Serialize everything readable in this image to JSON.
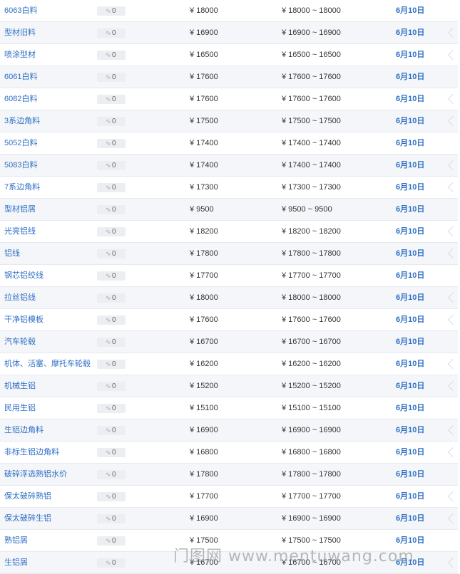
{
  "currency_symbol": "¥",
  "range_separator": "~",
  "change_icon": "trend-icon",
  "watermark_text": "门图网 www.mentuwang.com",
  "rows": [
    {
      "name": "6063白料",
      "change": "0",
      "price": "18000",
      "low": "18000",
      "high": "18000",
      "date": "6月10日"
    },
    {
      "name": "型材旧料",
      "change": "0",
      "price": "16900",
      "low": "16900",
      "high": "16900",
      "date": "6月10日"
    },
    {
      "name": "喷涂型材",
      "change": "0",
      "price": "16500",
      "low": "16500",
      "high": "16500",
      "date": "6月10日"
    },
    {
      "name": "6061白料",
      "change": "0",
      "price": "17600",
      "low": "17600",
      "high": "17600",
      "date": "6月10日"
    },
    {
      "name": "6082白料",
      "change": "0",
      "price": "17600",
      "low": "17600",
      "high": "17600",
      "date": "6月10日"
    },
    {
      "name": "3系边角料",
      "change": "0",
      "price": "17500",
      "low": "17500",
      "high": "17500",
      "date": "6月10日"
    },
    {
      "name": "5052白料",
      "change": "0",
      "price": "17400",
      "low": "17400",
      "high": "17400",
      "date": "6月10日"
    },
    {
      "name": "5083白料",
      "change": "0",
      "price": "17400",
      "low": "17400",
      "high": "17400",
      "date": "6月10日"
    },
    {
      "name": "7系边角料",
      "change": "0",
      "price": "17300",
      "low": "17300",
      "high": "17300",
      "date": "6月10日"
    },
    {
      "name": "型材铝屑",
      "change": "0",
      "price": "9500",
      "low": "9500",
      "high": "9500",
      "date": "6月10日"
    },
    {
      "name": "光亮铝线",
      "change": "0",
      "price": "18200",
      "low": "18200",
      "high": "18200",
      "date": "6月10日"
    },
    {
      "name": "铝线",
      "change": "0",
      "price": "17800",
      "low": "17800",
      "high": "17800",
      "date": "6月10日"
    },
    {
      "name": "钢芯铝绞线",
      "change": "0",
      "price": "17700",
      "low": "17700",
      "high": "17700",
      "date": "6月10日"
    },
    {
      "name": "拉丝铝线",
      "change": "0",
      "price": "18000",
      "low": "18000",
      "high": "18000",
      "date": "6月10日"
    },
    {
      "name": "干净铝模板",
      "change": "0",
      "price": "17600",
      "low": "17600",
      "high": "17600",
      "date": "6月10日"
    },
    {
      "name": "汽车轮毂",
      "change": "0",
      "price": "16700",
      "low": "16700",
      "high": "16700",
      "date": "6月10日"
    },
    {
      "name": "机体、活塞、摩托车轮毂",
      "change": "0",
      "price": "16200",
      "low": "16200",
      "high": "16200",
      "date": "6月10日"
    },
    {
      "name": "机械生铝",
      "change": "0",
      "price": "15200",
      "low": "15200",
      "high": "15200",
      "date": "6月10日"
    },
    {
      "name": "民用生铝",
      "change": "0",
      "price": "15100",
      "low": "15100",
      "high": "15100",
      "date": "6月10日"
    },
    {
      "name": "生铝边角料",
      "change": "0",
      "price": "16900",
      "low": "16900",
      "high": "16900",
      "date": "6月10日"
    },
    {
      "name": "非标生铝边角料",
      "change": "0",
      "price": "16800",
      "low": "16800",
      "high": "16800",
      "date": "6月10日"
    },
    {
      "name": "破碎浮选熟铝水价",
      "change": "0",
      "price": "17800",
      "low": "17800",
      "high": "17800",
      "date": "6月10日"
    },
    {
      "name": "保太破碎熟铝",
      "change": "0",
      "price": "17700",
      "low": "17700",
      "high": "17700",
      "date": "6月10日"
    },
    {
      "name": "保太破碎生铝",
      "change": "0",
      "price": "16900",
      "low": "16900",
      "high": "16900",
      "date": "6月10日"
    },
    {
      "name": "熟铝屑",
      "change": "0",
      "price": "17500",
      "low": "17500",
      "high": "17500",
      "date": "6月10日"
    },
    {
      "name": "生铝屑",
      "change": "0",
      "price": "16700",
      "low": "16700",
      "high": "16700",
      "date": "6月10日"
    }
  ]
}
